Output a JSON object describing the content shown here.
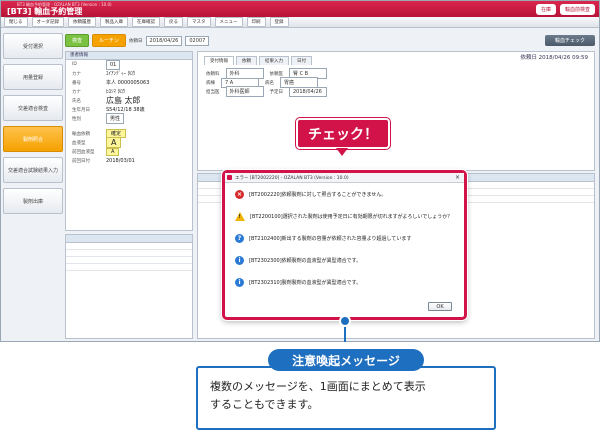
{
  "app": {
    "tiny_title": "BT3 輸血予約管理 - OZALAN BT3 (Version : 10.0)",
    "name": "[BT3] 輸血予約管理",
    "top_right": [
      "在庫",
      "輸血前検査"
    ],
    "menu": [
      "閉じる",
      "オーダ記録",
      "依頼履歴",
      "製品入庫",
      "在庫確認",
      "戻る",
      "マスタ",
      "メニュー",
      "印刷",
      "登録"
    ]
  },
  "sidebar": [
    "受付選択",
    "用量登録",
    "交差適合検査",
    "製剤照合",
    "交差適合試験結果入力",
    "製剤出庫"
  ],
  "toprow": {
    "pill1": "検査",
    "pill2": "ルーチン",
    "req_label": "依頼日",
    "req_date": "2018/04/26",
    "req_no": "02007",
    "check_button": "輸血チェック"
  },
  "patient": {
    "header": "患者情報",
    "rows": [
      {
        "k": "ID",
        "v": "01"
      },
      {
        "k": "カナ",
        "v": "ｴｲｱﾝﾃﾞｨｰ ﾀﾛｳ"
      },
      {
        "k": "番号",
        "v": "本人 0000005063"
      },
      {
        "k": "カナ",
        "v": "ﾋﾛｼﾏ ﾀﾛｳ"
      },
      {
        "k": "氏名",
        "v": "広島 太郎"
      },
      {
        "k": "生年月日",
        "v": "S54/12/18 38歳"
      },
      {
        "k": "性別",
        "v": "男性"
      }
    ],
    "blood_rows": [
      {
        "k": "輸血依頼",
        "v": "確定"
      },
      {
        "k": "血液型",
        "v": "A"
      },
      {
        "k": "前回血液型",
        "v": "A"
      },
      {
        "k": "前回日付",
        "v": "2018/03/01"
      }
    ]
  },
  "right_panel": {
    "tabs": [
      "受付情報",
      "依頼",
      "結果入力",
      "日付"
    ],
    "date": "依頼日 2018/04/26 09:59",
    "rows": [
      [
        "依頼科",
        "外科",
        "依頼医",
        "腎 C B"
      ],
      [
        "病棟",
        "7 A",
        "病名",
        "胃癌"
      ],
      [
        "担当医",
        "外科医師",
        "予定日",
        "2018/04/26"
      ]
    ]
  },
  "callout": "チェック！",
  "dialog": {
    "title": "エラー [BT2002220] - OZALAN BT3 (Version : 10.0)",
    "messages": [
      {
        "type": "error",
        "text": "[BT2002220]依頼製剤に対して照合することができません。"
      },
      {
        "type": "warning",
        "text": "[BT2200100]選択された製剤は使用予定日に有効期限が切れますがよろしいでしょうか？"
      },
      {
        "type": "question",
        "text": "[BT2102400]新出する製剤の容量が依頼された容量より超過しています"
      },
      {
        "type": "info",
        "text": "[BT2302300]依頼製剤の血液型が異型適合です。"
      },
      {
        "type": "info",
        "text": "[BT2302310]製剤製剤の血液型が異型適合です。"
      }
    ],
    "ok": "OK"
  },
  "caption": {
    "title": "注意喚起メッセージ",
    "line1": "複数のメッセージを、1画面にまとめて表示",
    "line2": "することもできます。"
  }
}
